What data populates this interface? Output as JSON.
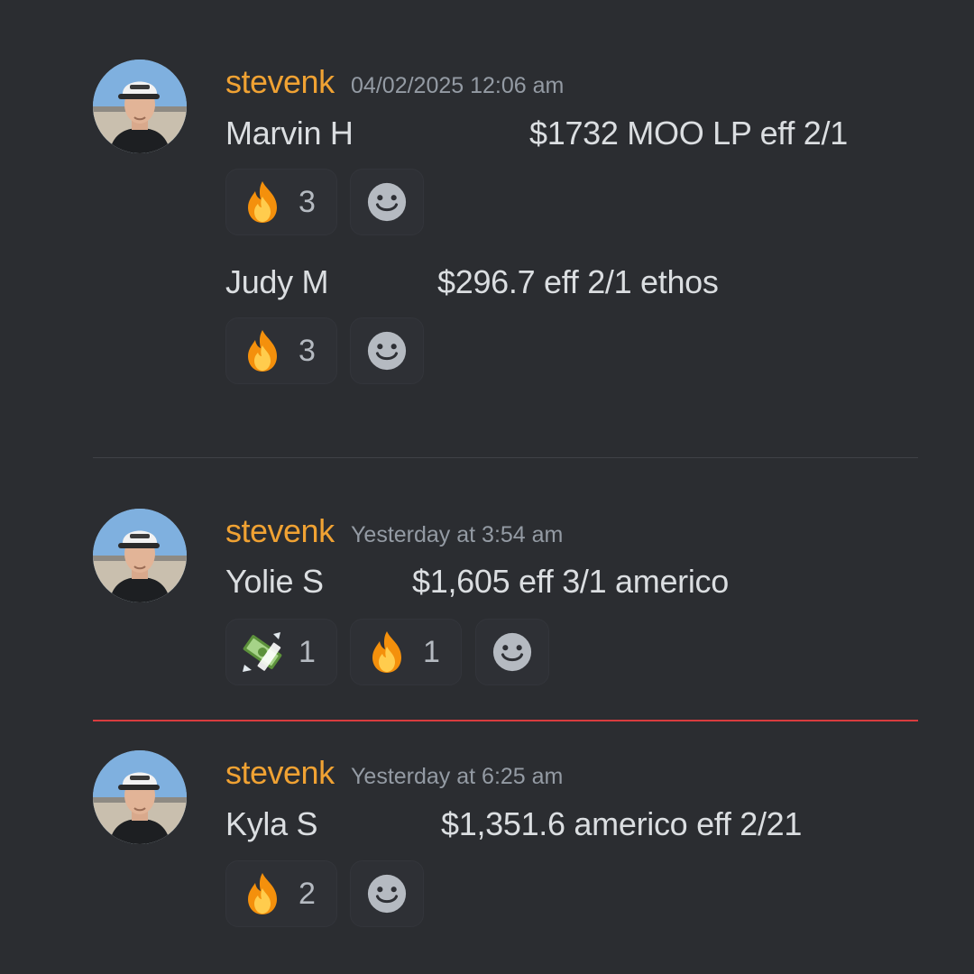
{
  "colors": {
    "background": "#2b2d31",
    "author": "#f0a233",
    "new_messages_divider": "#d83c3e"
  },
  "messages": [
    {
      "author": "stevenk",
      "timestamp": "04/02/2025 12:06 am",
      "avatar_icon": "user-avatar",
      "lines": [
        {
          "name": "Marvin H",
          "detail": "$1732 MOO LP eff 2/1",
          "reactions": [
            {
              "emoji": "fire-emoji",
              "count": "3"
            }
          ]
        },
        {
          "name": "Judy M",
          "detail": "$296.7 eff 2/1 ethos",
          "reactions": [
            {
              "emoji": "fire-emoji",
              "count": "3"
            }
          ]
        }
      ]
    },
    {
      "author": "stevenk",
      "timestamp": "Yesterday at 3:54 am",
      "avatar_icon": "user-avatar",
      "lines": [
        {
          "name": "Yolie S",
          "detail": "$1,605 eff 3/1 americo",
          "reactions": [
            {
              "emoji": "money-with-wings-emoji",
              "count": "1"
            },
            {
              "emoji": "fire-emoji",
              "count": "1"
            }
          ]
        }
      ]
    },
    {
      "author": "stevenk",
      "timestamp": "Yesterday at 6:25 am",
      "avatar_icon": "user-avatar",
      "lines": [
        {
          "name": "Kyla S",
          "detail": "$1,351.6 americo eff 2/21",
          "reactions": [
            {
              "emoji": "fire-emoji",
              "count": "2"
            }
          ]
        }
      ]
    }
  ]
}
